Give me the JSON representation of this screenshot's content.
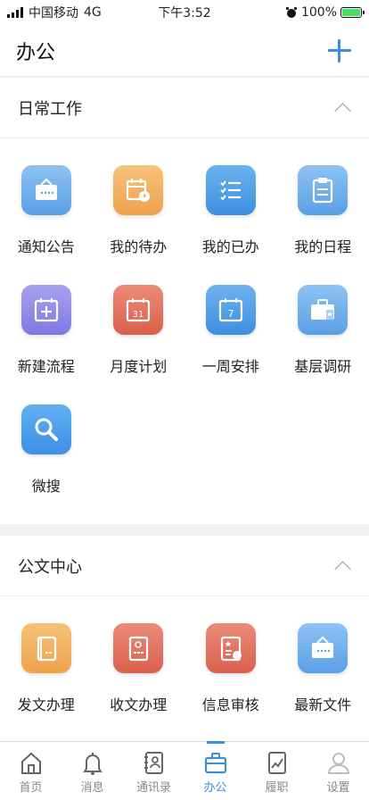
{
  "status_bar": {
    "carrier": "中国移动",
    "network": "4G",
    "time": "下午3:52",
    "battery": "100%",
    "battery_level": 1.0,
    "battery_color": "#4cd964"
  },
  "header": {
    "title": "办公",
    "add_icon": "plus-icon",
    "accent_color": "#3a8fd8"
  },
  "sections": [
    {
      "title": "日常工作",
      "toggle_icon": "chevron-up-icon",
      "items": [
        {
          "label": "通知公告",
          "icon": "notice-board-icon",
          "color_top": "#8ec3f2",
          "color_bottom": "#5a9fe6"
        },
        {
          "label": "我的待办",
          "icon": "calendar-clock-icon",
          "color_top": "#f5c27a",
          "color_bottom": "#eea24c"
        },
        {
          "label": "我的已办",
          "icon": "checklist-icon",
          "color_top": "#6cb3ee",
          "color_bottom": "#3f8ee0"
        },
        {
          "label": "我的日程",
          "icon": "clipboard-icon",
          "color_top": "#8ec3f2",
          "color_bottom": "#5a9fe6"
        },
        {
          "label": "新建流程",
          "icon": "calendar-plus-icon",
          "color_top": "#a9a2f0",
          "color_bottom": "#7f78e3"
        },
        {
          "label": "月度计划",
          "icon": "calendar-31-icon",
          "color_top": "#ec8b78",
          "color_bottom": "#d9604d"
        },
        {
          "label": "一周安排",
          "icon": "calendar-7-icon",
          "color_top": "#6cb3ee",
          "color_bottom": "#3f8ee0"
        },
        {
          "label": "基层调研",
          "icon": "briefcase-icon",
          "color_top": "#8ec3f2",
          "color_bottom": "#5a9fe6"
        },
        {
          "label": "微搜",
          "icon": "search-icon",
          "color_top": "#5fb0f2",
          "color_bottom": "#3f90e6"
        }
      ]
    },
    {
      "title": "公文中心",
      "toggle_icon": "chevron-up-icon",
      "items": [
        {
          "label": "发文办理",
          "icon": "document-folder-icon",
          "color_top": "#f5c27a",
          "color_bottom": "#eea24c"
        },
        {
          "label": "收文办理",
          "icon": "document-receive-icon",
          "color_top": "#ec8b78",
          "color_bottom": "#d9604d"
        },
        {
          "label": "信息审核",
          "icon": "document-review-icon",
          "color_top": "#ec8b78",
          "color_bottom": "#d9604d"
        },
        {
          "label": "最新文件",
          "icon": "notice-board-icon",
          "color_top": "#8ec3f2",
          "color_bottom": "#5a9fe6"
        }
      ]
    }
  ],
  "tabs": [
    {
      "label": "首页",
      "icon": "home-icon",
      "active": false
    },
    {
      "label": "消息",
      "icon": "bell-icon",
      "active": false
    },
    {
      "label": "通讯录",
      "icon": "contacts-icon",
      "active": false
    },
    {
      "label": "办公",
      "icon": "briefcase-icon",
      "active": true
    },
    {
      "label": "履职",
      "icon": "chart-icon",
      "active": false
    },
    {
      "label": "设置",
      "icon": "user-icon",
      "active": false
    }
  ]
}
